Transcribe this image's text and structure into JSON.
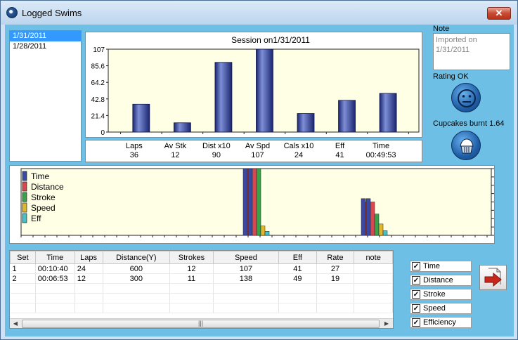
{
  "window": {
    "title": "Logged Swims",
    "close_label": "✕"
  },
  "dates": [
    "1/31/2011",
    "1/28/2011"
  ],
  "note": {
    "label": "Note",
    "text": "Imported on 1/31/2011"
  },
  "rating": {
    "label": "Rating OK",
    "icon": "neutral-face-icon"
  },
  "cupcakes": {
    "label": "Cupcakes burnt 1.64",
    "icon": "cupcake-icon"
  },
  "stats": [
    {
      "label": "Laps",
      "value": "36"
    },
    {
      "label": "Av Stk",
      "value": "12"
    },
    {
      "label": "Dist x10",
      "value": "90"
    },
    {
      "label": "Av Spd",
      "value": "107"
    },
    {
      "label": "Cals x10",
      "value": "24"
    },
    {
      "label": "Eff",
      "value": "41"
    },
    {
      "label": "Time",
      "value": "00:49:53"
    }
  ],
  "chart_data": {
    "type": "bar",
    "title": "Session on1/31/2011",
    "categories": [
      "Laps",
      "Av Stk",
      "Dist x10",
      "Av Spd",
      "Cals x10",
      "Eff",
      "Time"
    ],
    "values": [
      36,
      12,
      90,
      107,
      24,
      41,
      50
    ],
    "ylim": [
      0,
      107
    ],
    "yticks": [
      "0",
      "21.4",
      "42.8",
      "64.2",
      "85.6",
      "107"
    ],
    "color": "#2e3f9a",
    "background": "#ffffe6"
  },
  "timeline_chart": {
    "legend": [
      {
        "name": "Time",
        "color": "#3a4aa3"
      },
      {
        "name": "Distance",
        "color": "#d9474f"
      },
      {
        "name": "Stroke",
        "color": "#3aa34a"
      },
      {
        "name": "Speed",
        "color": "#e0b830"
      },
      {
        "name": "Eff",
        "color": "#46c0c9"
      }
    ],
    "groups": [
      {
        "values": [
          100,
          100,
          80,
          0,
          0
        ]
      },
      {
        "values": [
          100,
          100,
          100,
          14,
          6
        ]
      },
      {
        "values": [
          55,
          50,
          32,
          0,
          0
        ]
      },
      {
        "values": [
          55,
          50,
          32,
          17,
          7
        ]
      }
    ]
  },
  "table": {
    "columns": [
      "Set",
      "Time",
      "Laps",
      "Distance(Y)",
      "Strokes",
      "Speed",
      "Eff",
      "Rate",
      "note"
    ],
    "rows": [
      [
        "1",
        "00:10:40",
        "24",
        "600",
        "12",
        "107",
        "41",
        "27",
        ""
      ],
      [
        "2",
        "00:06:53",
        "12",
        "300",
        "11",
        "138",
        "49",
        "19",
        ""
      ]
    ],
    "scroll_thumb": "|||"
  },
  "toggles": [
    {
      "label": "Time",
      "checked": true
    },
    {
      "label": "Distance",
      "checked": true
    },
    {
      "label": "Stroke",
      "checked": true
    },
    {
      "label": "Speed",
      "checked": true
    },
    {
      "label": "Efficiency",
      "checked": true
    }
  ],
  "export_button": {
    "icon": "export-arrow-icon"
  }
}
